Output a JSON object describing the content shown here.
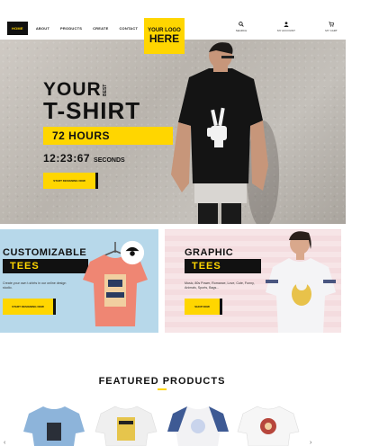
{
  "nav": {
    "items": [
      "HOME",
      "ABOUT",
      "PRODUCTS",
      "CREATE",
      "CONTACT"
    ]
  },
  "logo": {
    "line1": "YOUR LOGO",
    "line2": "HERE"
  },
  "header_actions": [
    {
      "icon": "search-icon",
      "label": "SEARCH"
    },
    {
      "icon": "user-icon",
      "label": "MY ACCOUNT"
    },
    {
      "icon": "cart-icon",
      "label": "MY CART"
    }
  ],
  "hero": {
    "line1": "YOUR",
    "best": "BEST",
    "line2": "T-SHIRT",
    "band": "72 HOURS",
    "timer": "12:23:67",
    "timer_label": "SECONDS",
    "button": "START DESIGNING NOW"
  },
  "promos": {
    "left": {
      "title": "CUSTOMIZABLE",
      "band": "TEES",
      "desc": "Create your own t-shirts in our online design studio.",
      "button": "START DESIGNING NOW"
    },
    "right": {
      "title": "GRAPHIC",
      "band": "TEES",
      "desc": "Music, 80s Power, Romance, Love, Cute, Funny, Animals, Sports, Bags...",
      "button": "SHOP NOW"
    }
  },
  "featured": {
    "title": "FEATURED PRODUCTS"
  },
  "colors": {
    "accent": "#ffd600",
    "dark": "#111111"
  }
}
